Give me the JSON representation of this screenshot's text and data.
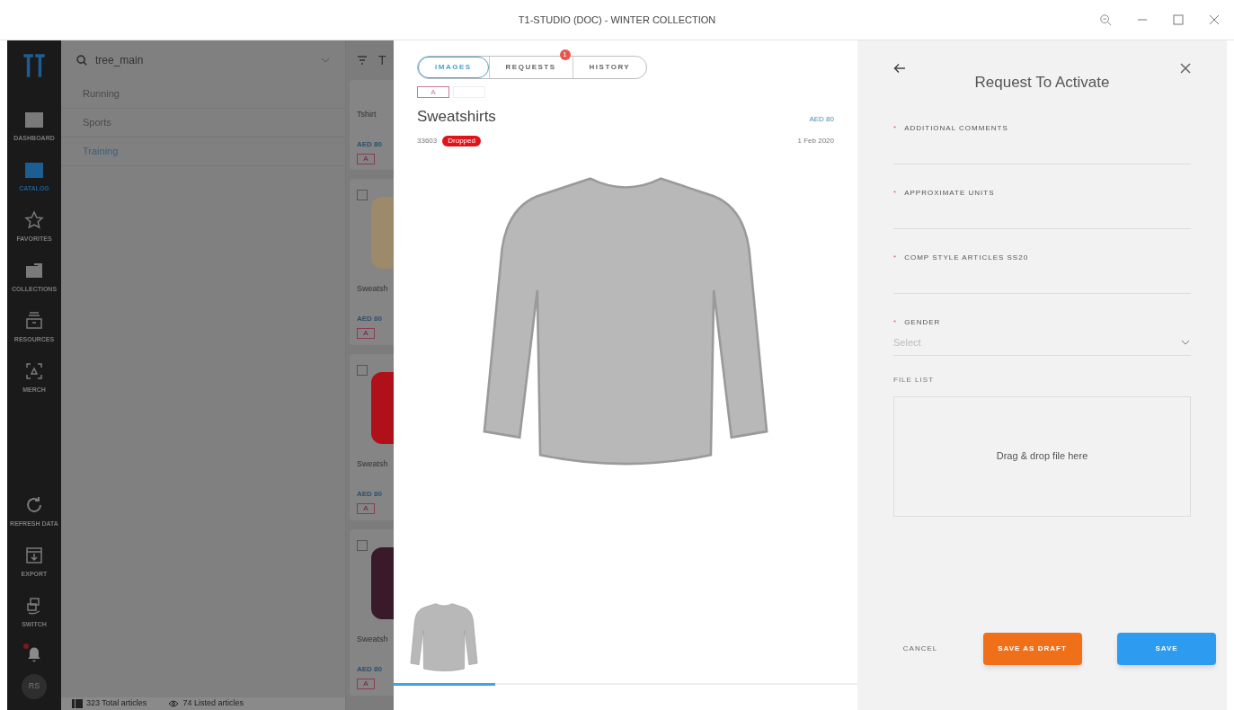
{
  "window": {
    "title": "T1-STUDIO (DOC) - WINTER COLLECTION"
  },
  "nav": {
    "items": [
      {
        "label": "DASHBOARD",
        "selected": false
      },
      {
        "label": "CATALOG",
        "selected": true
      },
      {
        "label": "FAVORITES",
        "selected": false
      },
      {
        "label": "COLLECTIONS",
        "selected": false
      },
      {
        "label": "RESOURCES",
        "selected": false
      },
      {
        "label": "MERCH",
        "selected": false
      }
    ],
    "bottom_items": [
      {
        "label": "REFRESH DATA"
      },
      {
        "label": "EXPORT"
      },
      {
        "label": "SWITCH"
      }
    ],
    "notifications_unread": true,
    "avatar": "RS"
  },
  "tree": {
    "search_value": "tree_main",
    "items": [
      {
        "label": "Running",
        "selected": false
      },
      {
        "label": "Sports",
        "selected": false
      },
      {
        "label": "Training",
        "selected": true
      }
    ]
  },
  "articles": {
    "header": "T",
    "cards": [
      {
        "kind": "compact",
        "name": "Tshirt",
        "price": "AED 80",
        "tag": "A"
      },
      {
        "kind": "photo",
        "checked": false,
        "name": "Sweatsh",
        "price": "AED 80",
        "tag": "A"
      },
      {
        "kind": "photo",
        "checked": false,
        "name": "Sweatsh",
        "price": "AED 80",
        "tag": "A"
      },
      {
        "kind": "photo",
        "checked": false,
        "name": "Sweatsh",
        "price": "AED 80",
        "tag": "A"
      }
    ]
  },
  "status_bar": {
    "total": "323 Total articles",
    "listed": "74 Listed articles"
  },
  "detail": {
    "tabs": [
      {
        "label": "IMAGES",
        "selected": true
      },
      {
        "label": "REQUESTS",
        "selected": false,
        "badge": "1"
      },
      {
        "label": "HISTORY",
        "selected": false
      }
    ],
    "variants": [
      {
        "label": "A",
        "selected": true
      },
      {
        "selected": false
      }
    ],
    "title": "Sweatshirts",
    "price": "AED 80",
    "article_number": "33603",
    "status": "Dropped",
    "date": "1 Feb 2020",
    "thumbnails": [
      {
        "selected": true
      }
    ]
  },
  "request_form": {
    "title": "Request To Activate",
    "fields": [
      {
        "kind": "text",
        "label": "ADDITIONAL COMMENTS",
        "marker": "*"
      },
      {
        "kind": "text",
        "label": "APPROXIMATE UNITS",
        "marker": "*"
      },
      {
        "kind": "text",
        "label": "COMP STYLE ARTICLES SS20",
        "marker": "*"
      },
      {
        "kind": "select",
        "label": "GENDER",
        "marker": "*",
        "placeholder": "Select"
      }
    ],
    "file_list_label": "FILE LIST",
    "dropzone": "Drag & drop file here",
    "buttons": [
      {
        "label": "CANCEL",
        "kind": "text"
      },
      {
        "label": "SAVE AS DRAFT",
        "kind": "warning"
      },
      {
        "label": "SAVE",
        "kind": "primary"
      }
    ]
  }
}
